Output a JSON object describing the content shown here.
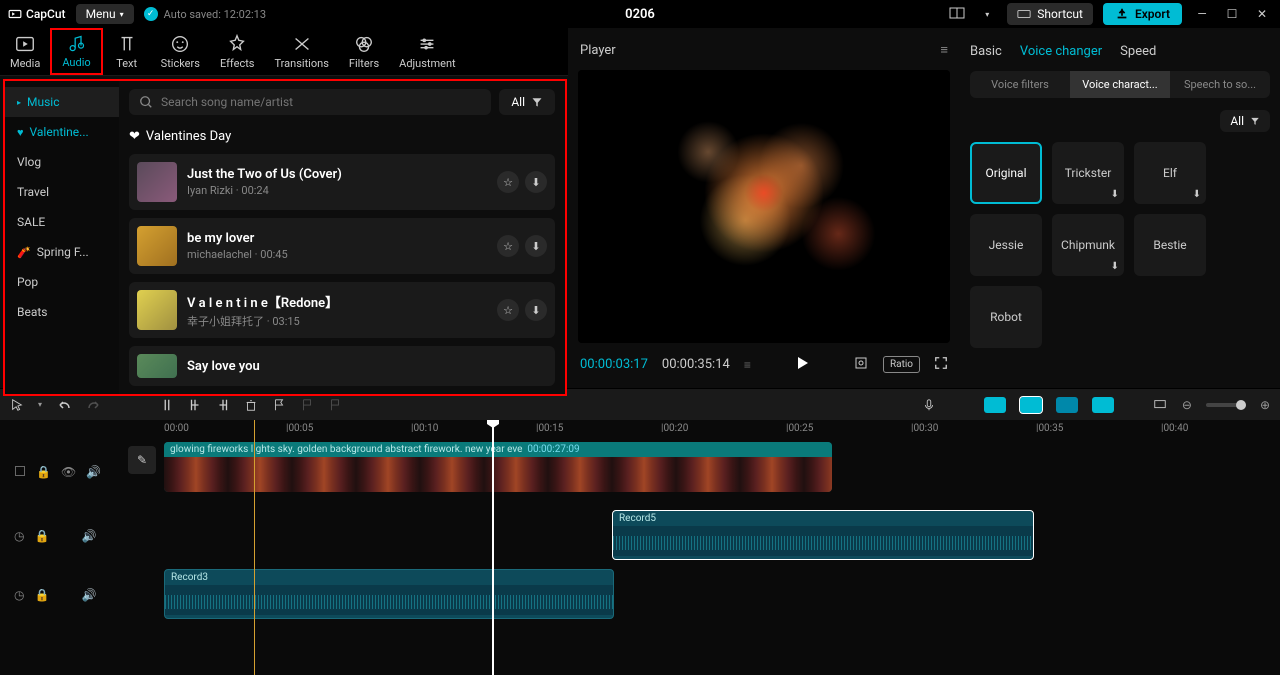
{
  "titlebar": {
    "app_name": "CapCut",
    "menu": "Menu",
    "auto_saved": "Auto saved: 12:02:13",
    "project": "0206",
    "shortcut": "Shortcut",
    "export": "Export"
  },
  "top_tabs": [
    "Media",
    "Audio",
    "Text",
    "Stickers",
    "Effects",
    "Transitions",
    "Filters",
    "Adjustment"
  ],
  "audio_sidebar": {
    "music": "Music",
    "valentine": "Valentine...",
    "items": [
      "Vlog",
      "Travel",
      "SALE",
      "Spring F...",
      "Pop",
      "Beats"
    ]
  },
  "search": {
    "placeholder": "Search song name/artist",
    "all": "All"
  },
  "section": "Valentines Day",
  "tracks": [
    {
      "title": "Just the Two of Us (Cover)",
      "artist": "Iyan Rizki",
      "dur": "00:24"
    },
    {
      "title": "be my lover",
      "artist": "michaelachel",
      "dur": "00:45"
    },
    {
      "title": "V a l e n t i n e【Redone】",
      "artist": "幸子小姐拜托了",
      "dur": "03:15"
    },
    {
      "title": "Say love you",
      "artist": "",
      "dur": ""
    }
  ],
  "player": {
    "title": "Player",
    "current": "00:00:03:17",
    "duration": "00:00:35:14",
    "ratio": "Ratio"
  },
  "right": {
    "tabs": [
      "Basic",
      "Voice changer",
      "Speed"
    ],
    "subtabs": [
      "Voice filters",
      "Voice charact...",
      "Speech to so..."
    ],
    "all": "All",
    "voices": [
      "Original",
      "Trickster",
      "Elf",
      "Jessie",
      "Chipmunk",
      "Bestie",
      "Robot"
    ]
  },
  "timeline": {
    "ticks": [
      "00:00",
      "|00:05",
      "|00:10",
      "|00:15",
      "|00:20",
      "|00:25",
      "|00:30",
      "|00:35",
      "|00:40"
    ],
    "video_label": "glowing fireworks lights sky. golden background abstract firework. new year eve",
    "video_dur": "00:00:27:09",
    "rec5": "Record5",
    "rec3": "Record3"
  }
}
